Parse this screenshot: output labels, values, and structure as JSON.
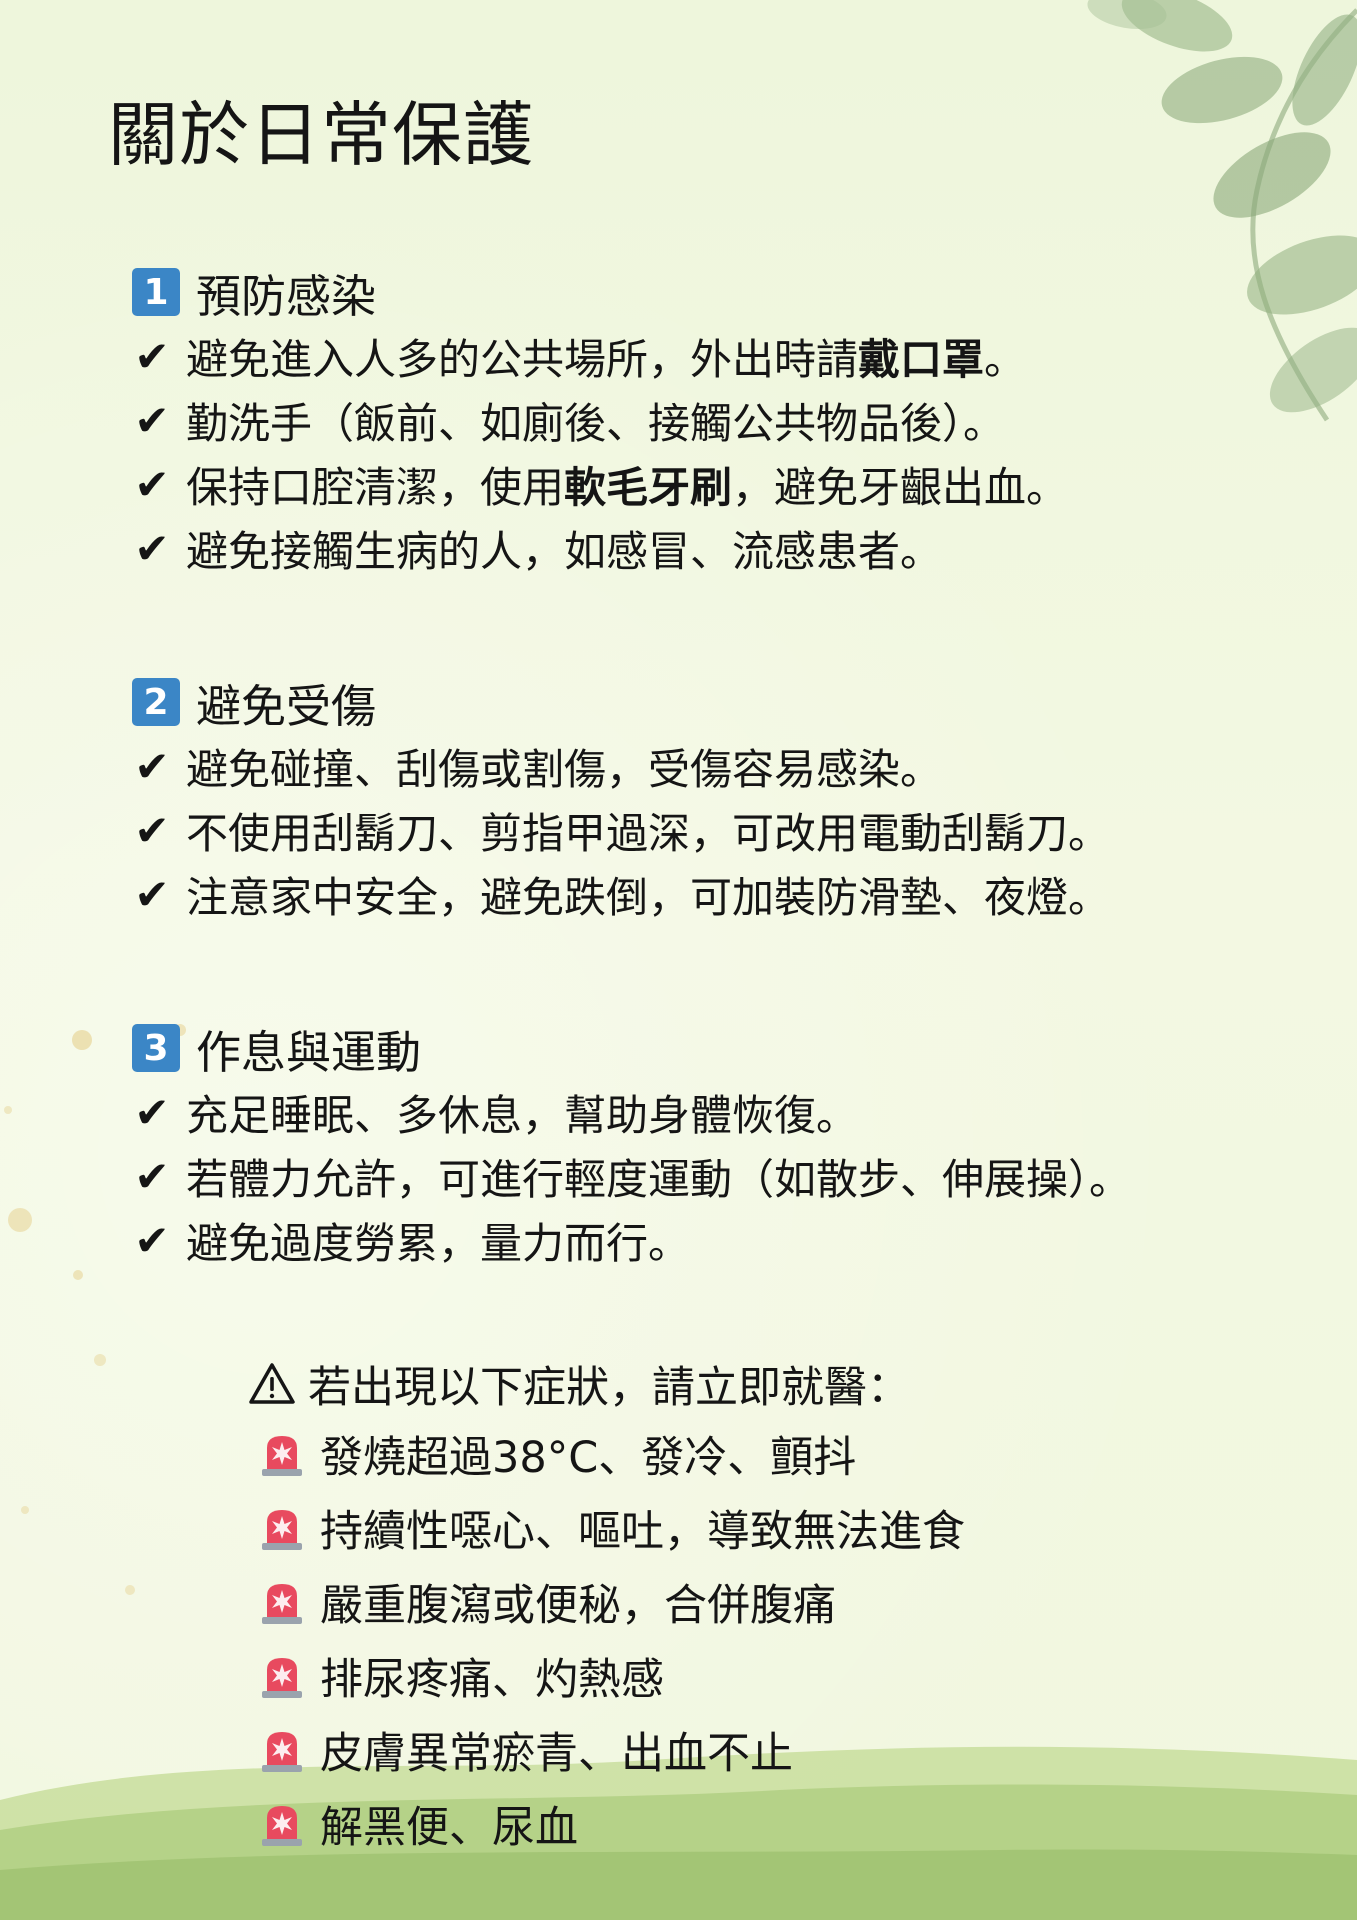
{
  "title": "關於日常保護",
  "sections": [
    {
      "number": "1",
      "heading": "預防感染",
      "items": [
        {
          "check": "✔",
          "pre": "避免進入人多的公共場所，外出時請",
          "bold": "戴口罩",
          "post": "。"
        },
        {
          "check": "✔",
          "pre": "勤洗手（飯前、如廁後、接觸公共物品後）。",
          "bold": "",
          "post": ""
        },
        {
          "check": "✔",
          "pre": "保持口腔清潔，使用",
          "bold": "軟毛牙刷",
          "post": "，避免牙齦出血。"
        },
        {
          "check": "✔",
          "pre": "避免接觸生病的人，如感冒、流感患者。",
          "bold": "",
          "post": ""
        }
      ]
    },
    {
      "number": "2",
      "heading": "避免受傷",
      "items": [
        {
          "check": "✔",
          "pre": "避免碰撞、刮傷或割傷，受傷容易感染。",
          "bold": "",
          "post": ""
        },
        {
          "check": "✔",
          "pre": "不使用刮鬍刀、剪指甲過深，可改用電動刮鬍刀。",
          "bold": "",
          "post": ""
        },
        {
          "check": "✔",
          "pre": "注意家中安全，避免跌倒，可加裝防滑墊、夜燈。",
          "bold": "",
          "post": ""
        }
      ]
    },
    {
      "number": "3",
      "heading": "作息與運動",
      "items": [
        {
          "check": "✔",
          "pre": "充足睡眠、多休息，幫助身體恢復。",
          "bold": "",
          "post": ""
        },
        {
          "check": "✔",
          "pre": "若體力允許，可進行輕度運動（如散步、伸展操）。",
          "bold": "",
          "post": ""
        },
        {
          "check": "✔",
          "pre": "避免過度勞累，量力而行。",
          "bold": "",
          "post": ""
        }
      ]
    }
  ],
  "warning": {
    "icon": "warning-icon",
    "heading": "若出現以下症狀，請立即就醫：",
    "symptom_icon": "siren-icon",
    "symptoms": [
      "發燒超過38°C、發冷、顫抖",
      "持續性噁心、嘔吐，導致無法進食",
      "嚴重腹瀉或便秘，合併腹痛",
      "排尿疼痛、灼熱感",
      "皮膚異常瘀青、出血不止",
      "解黑便、尿血"
    ]
  },
  "colors": {
    "background": "#f2f8e0",
    "badge": "#3b86c6",
    "siren": "#e84a5f",
    "leaf": "#8fae7e",
    "grass": "#a9c97a"
  }
}
